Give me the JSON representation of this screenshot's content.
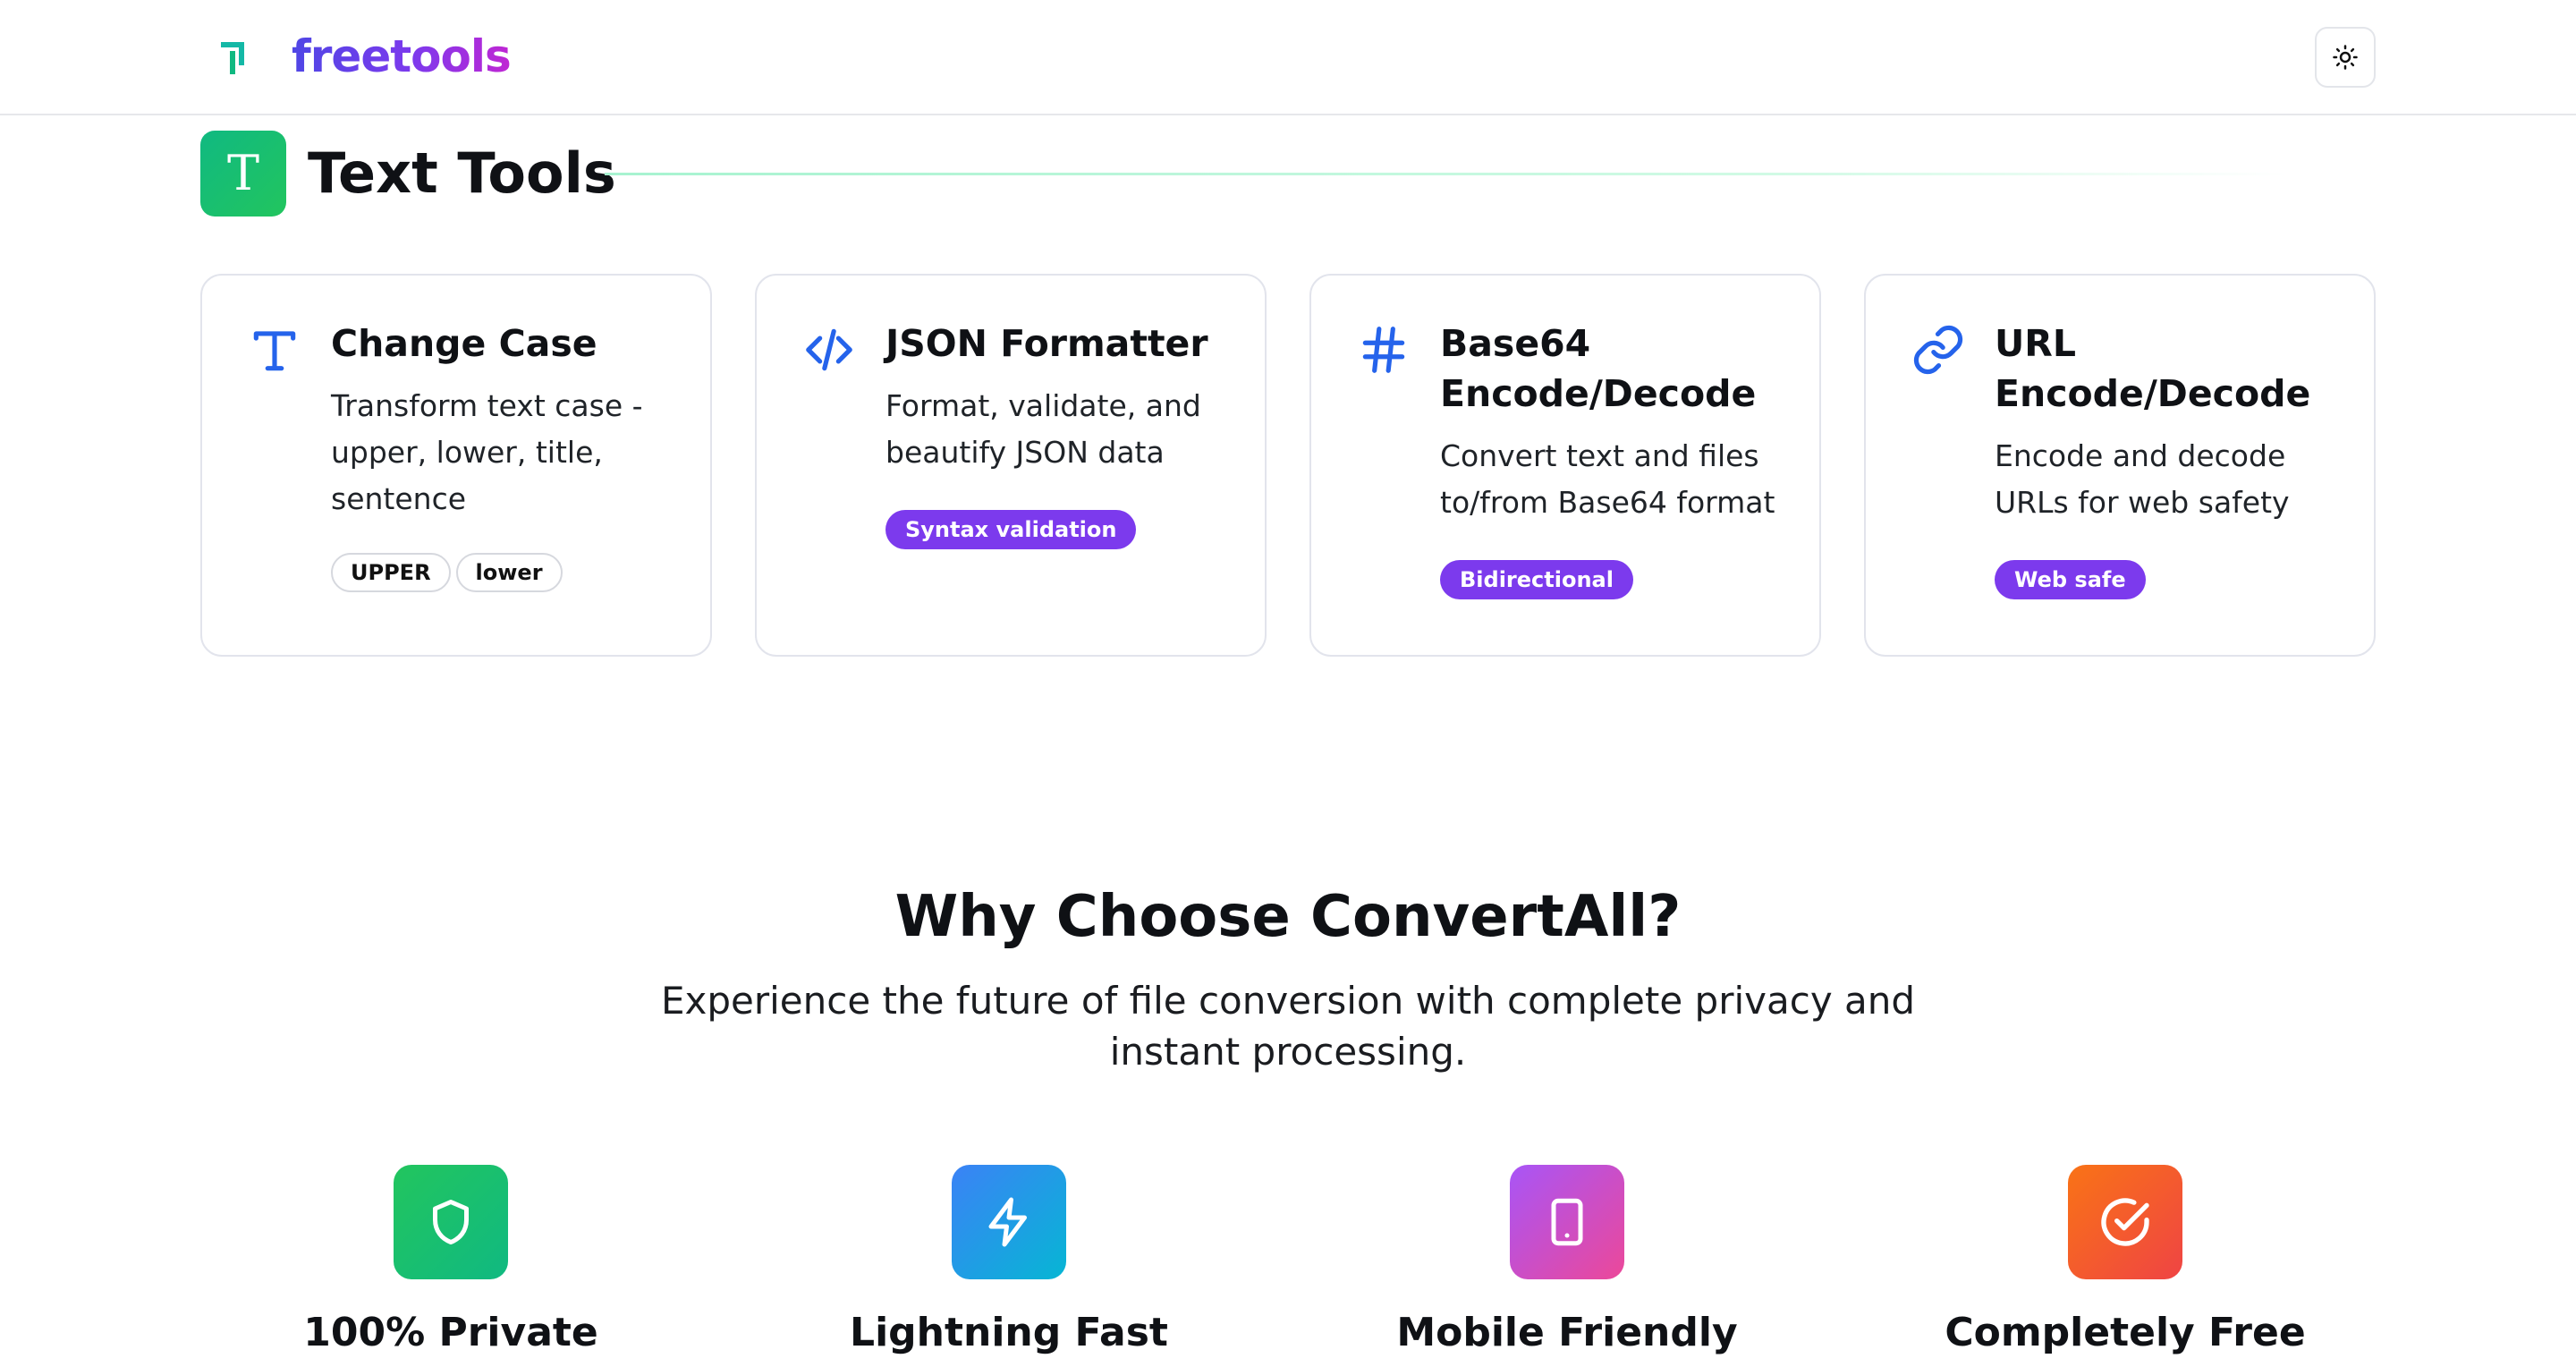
{
  "brand": {
    "name": "freetools"
  },
  "header": {
    "theme_toggle_icon": "sun-icon"
  },
  "section": {
    "title": "Text Tools",
    "icon_letter": "T",
    "accent": "#10b981"
  },
  "cards": [
    {
      "title": "Change Case",
      "description": "Transform text case - upper, lower, title, sentence",
      "icon": "text-case-icon",
      "tags": [
        "UPPER",
        "lower"
      ]
    },
    {
      "title": "JSON Formatter",
      "description": "Format, validate, and beautify JSON data",
      "icon": "code-icon",
      "badge": "Syntax validation"
    },
    {
      "title": "Base64 Encode/Decode",
      "description": "Convert text and files to/from Base64 format",
      "icon": "hash-icon",
      "badge": "Bidirectional"
    },
    {
      "title": "URL Encode/Decode",
      "description": "Encode and decode URLs for web safety",
      "icon": "link-icon",
      "badge": "Web safe"
    }
  ],
  "why": {
    "title": "Why Choose ConvertAll?",
    "subtitle": "Experience the future of file conversion with complete privacy and instant processing."
  },
  "features": [
    {
      "label": "100% Private",
      "icon": "shield-icon",
      "color": "#22c55e"
    },
    {
      "label": "Lightning Fast",
      "icon": "lightning-icon",
      "color": "#3b82f6"
    },
    {
      "label": "Mobile Friendly",
      "icon": "mobile-icon",
      "color": "#d946ef"
    },
    {
      "label": "Completely Free",
      "icon": "check-circle-icon",
      "color": "#f97316"
    }
  ],
  "colors": {
    "card_icon": "#2563eb",
    "badge": "#7c3aed",
    "brand_gradient": [
      "#4f46e5",
      "#c026d3"
    ]
  }
}
